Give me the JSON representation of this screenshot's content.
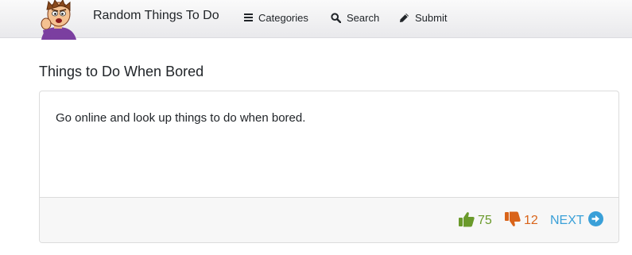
{
  "header": {
    "brand": "Random Things To Do",
    "nav": {
      "categories_label": "Categories",
      "search_label": "Search",
      "submit_label": "Submit"
    }
  },
  "main": {
    "title": "Things to Do When Bored",
    "card": {
      "text": "Go online and look up things to do when bored.",
      "upvotes": "75",
      "downvotes": "12",
      "next_label": "NEXT"
    }
  },
  "colors": {
    "upvote": "#6a9a2b",
    "downvote": "#d9641a",
    "next": "#3aa0d8"
  },
  "icons": {
    "logo": "cartoon-boy-mascot",
    "categories": "bars-icon",
    "search": "search-icon",
    "submit": "pencil-icon",
    "upvote": "thumbs-up-icon",
    "downvote": "thumbs-down-icon",
    "next": "arrow-circle-right-icon"
  }
}
